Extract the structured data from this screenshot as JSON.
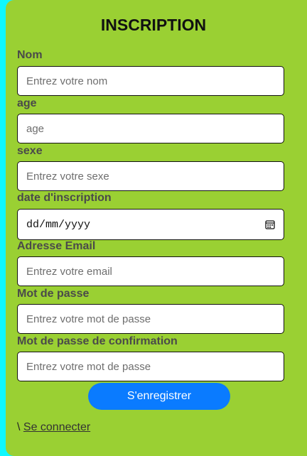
{
  "form": {
    "title": "INSCRIPTION",
    "fields": [
      {
        "label": "Nom",
        "placeholder": "Entrez votre nom"
      },
      {
        "label": "age",
        "placeholder": "age"
      },
      {
        "label": "sexe",
        "placeholder": "Entrez votre sexe"
      },
      {
        "label": "date d'inscription",
        "placeholder": "dd/mm/yyyy"
      },
      {
        "label": "Adresse Email",
        "placeholder": "Entrez votre email"
      },
      {
        "label": "Mot de passe",
        "placeholder": "Entrez votre mot de passe"
      },
      {
        "label": "Mot de passe de confirmation",
        "placeholder": "Entrez votre mot de passe"
      }
    ],
    "submit_label": "S'enregistrer",
    "login_prefix": "\\ ",
    "login_link": "Se connecter"
  },
  "colors": {
    "page_edge": "#0ff8ff",
    "card_background": "#9ad033",
    "button": "#0a7bff"
  },
  "icons": {
    "date_picker": "calendar-icon"
  }
}
